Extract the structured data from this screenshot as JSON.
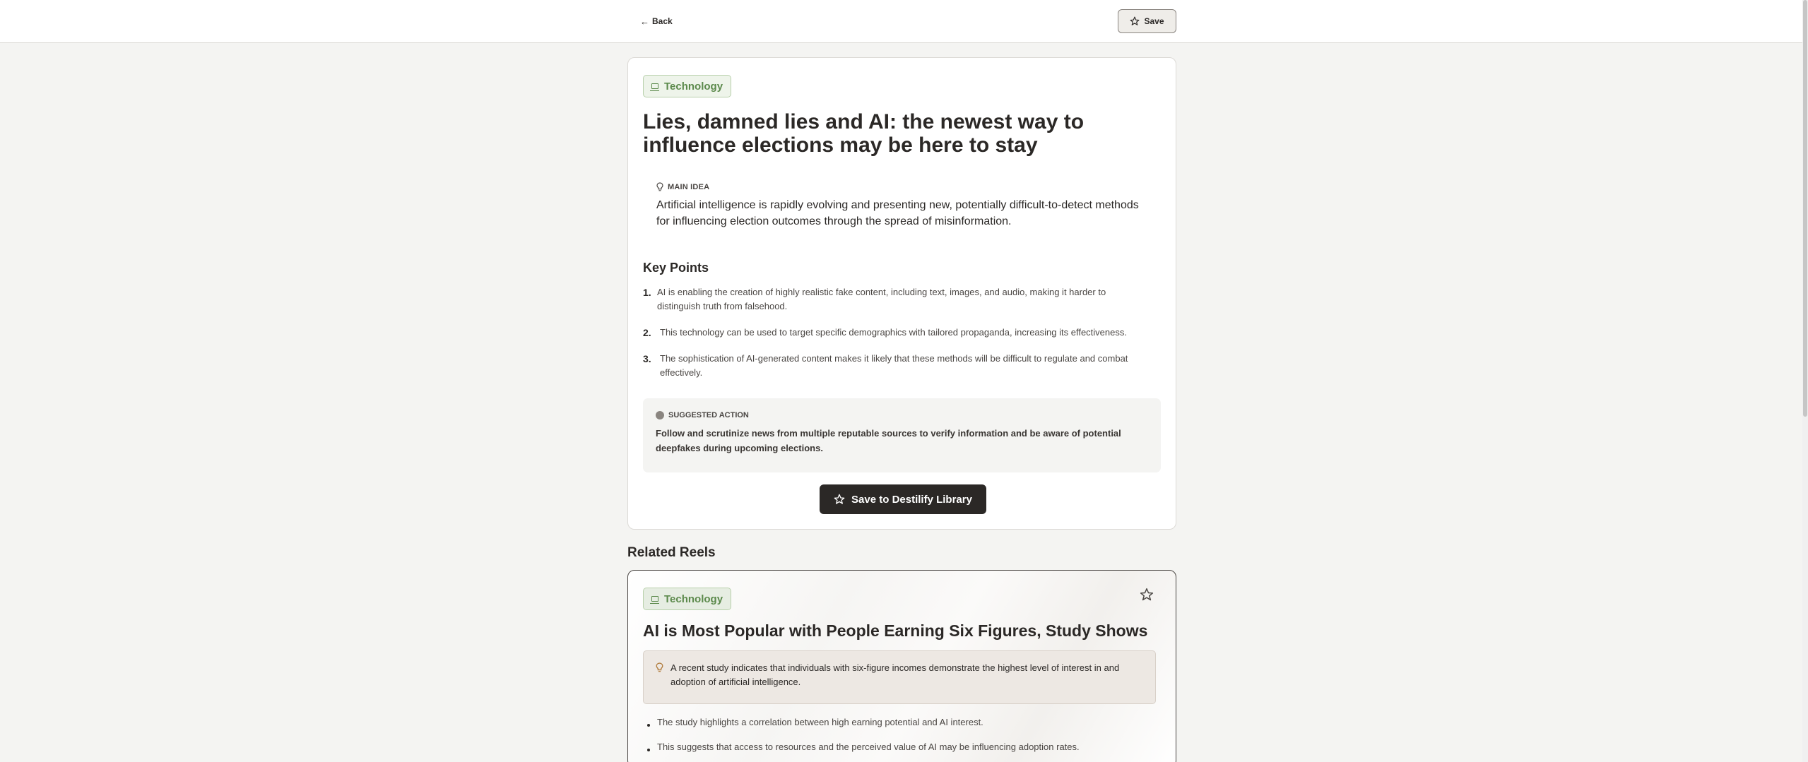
{
  "header": {
    "back_label": "Back",
    "save_label": "Save"
  },
  "article": {
    "category": "Technology",
    "title": "Lies, damned lies and AI: the newest way to influence elections may be here to stay",
    "main_idea_label": "MAIN IDEA",
    "main_idea": "Artificial intelligence is rapidly evolving and presenting new, potentially difficult-to-detect methods for influencing election outcomes through the spread of misinformation.",
    "key_points_heading": "Key Points",
    "key_points": [
      {
        "num": "1.",
        "text": "AI is enabling the creation of highly realistic fake content, including text, images, and audio, making it harder to distinguish truth from falsehood."
      },
      {
        "num": "2.",
        "text": "This technology can be used to target specific demographics with tailored propaganda, increasing its effectiveness."
      },
      {
        "num": "3.",
        "text": "The sophistication of AI-generated content makes it likely that these methods will be difficult to regulate and combat effectively."
      }
    ],
    "suggested_action_label": "SUGGESTED ACTION",
    "suggested_action": "Follow and scrutinize news from multiple reputable sources to verify information and be aware of potential deepfakes during upcoming elections.",
    "library_button_label": "Save to Destilify Library"
  },
  "related": {
    "heading": "Related Reels",
    "reels": [
      {
        "category": "Technology",
        "title": "AI is Most Popular with People Earning Six Figures, Study Shows",
        "summary": "A recent study indicates that individuals with six-figure incomes demonstrate the highest level of interest in and adoption of artificial intelligence.",
        "points": [
          "The study highlights a correlation between high earning potential and AI interest.",
          "This suggests that access to resources and the perceived value of AI may be influencing adoption rates."
        ]
      }
    ]
  },
  "icons": {
    "back": "arrow-left-icon",
    "save": "star-icon",
    "category": "laptop-icon",
    "main_idea": "lightbulb-icon",
    "action": "circle-icon"
  },
  "colors": {
    "accent_dark": "#2b2826",
    "tag_green": "#5c8a4c",
    "tag_bg": "#eef4ea",
    "background": "#f4f4f2"
  }
}
